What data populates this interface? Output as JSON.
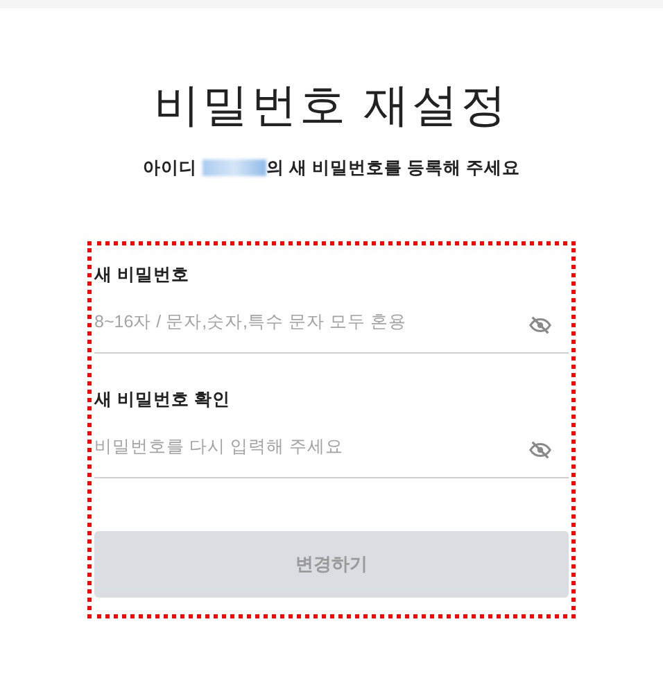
{
  "title": "비밀번호 재설정",
  "subtitle": {
    "prefix": "아이디",
    "suffix": "의 새 비밀번호를 등록해 주세요"
  },
  "fields": [
    {
      "label": "새 비밀번호",
      "placeholder": "8~16자 / 문자,숫자,특수 문자 모두 혼용"
    },
    {
      "label": "새 비밀번호 확인",
      "placeholder": "비밀번호를 다시 입력해 주세요"
    }
  ],
  "submit": {
    "label": "변경하기",
    "disabled": true
  }
}
